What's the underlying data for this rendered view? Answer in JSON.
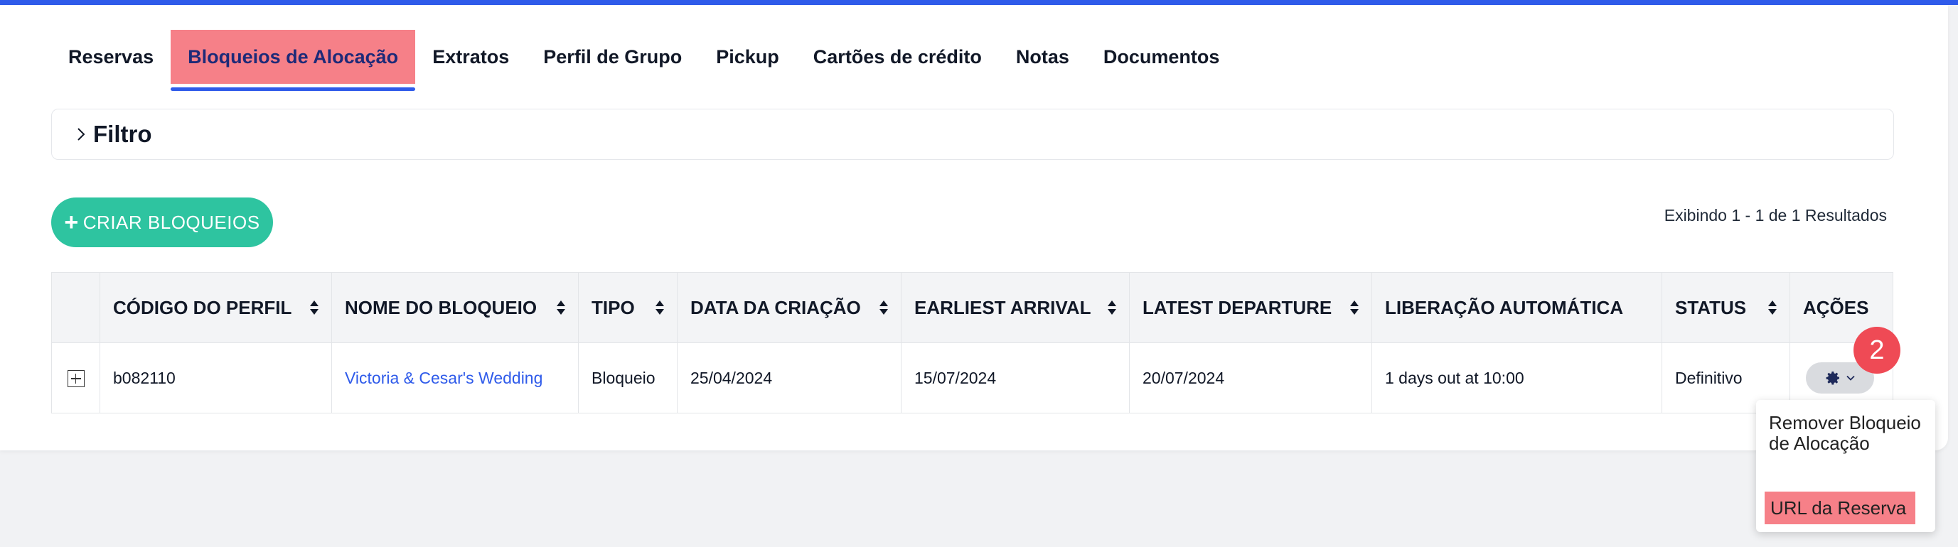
{
  "tabs": [
    "Reservas",
    "Bloqueios de Alocação",
    "Extratos",
    "Perfil de Grupo",
    "Pickup",
    "Cartões de crédito",
    "Notas",
    "Documentos"
  ],
  "active_tab": "Bloqueios de Alocação",
  "filter": {
    "title": "Filtro"
  },
  "create_button": {
    "label": "CRIAR BLOQUEIOS",
    "icon": "plus-icon"
  },
  "results_text": "Exibindo 1 - 1 de 1 Resultados",
  "table": {
    "headers": [
      "CÓDIGO DO PERFIL",
      "NOME DO BLOQUEIO",
      "TIPO",
      "DATA DA CRIAÇÃO",
      "EARLIEST ARRIVAL",
      "LATEST DEPARTURE",
      "LIBERAÇÃO AUTOMÁTICA",
      "STATUS",
      "AÇÕES"
    ],
    "rows": [
      {
        "codigo": "b082110",
        "nome": "Victoria & Cesar's Wedding",
        "tipo": "Bloqueio",
        "data_criacao": "25/04/2024",
        "earliest_arrival": "15/07/2024",
        "latest_departure": "20/07/2024",
        "liberacao": "1 days out at 10:00",
        "status": "Definitivo"
      }
    ]
  },
  "badge": "2",
  "dropdown": {
    "items": [
      "Remover Bloqueio de Alocação",
      "URL da Reserva"
    ]
  },
  "colors": {
    "accent": "#2f5bea",
    "create_button": "#2ec4a0",
    "highlight": "#f68088",
    "badge": "#ef4a55",
    "link": "#2f5bea"
  }
}
